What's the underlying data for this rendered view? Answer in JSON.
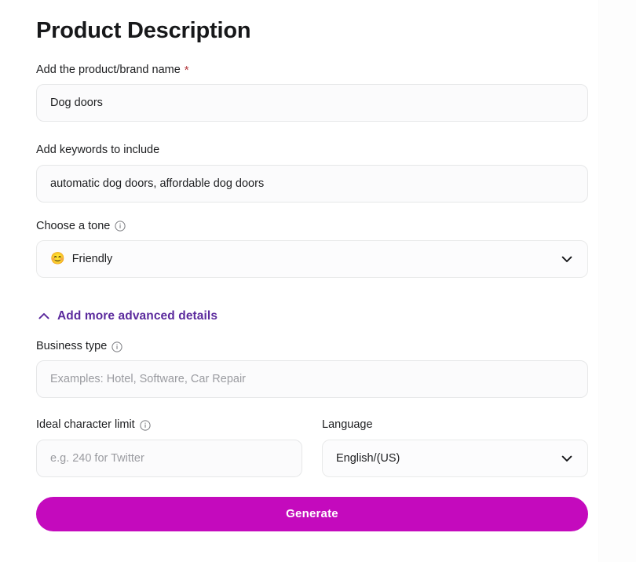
{
  "header": {
    "title": "Product Description"
  },
  "colors": {
    "accent_purple": "#5b2a9d",
    "brand_magenta": "#c40abd",
    "required_star": "#b3373c",
    "text_primary": "#1d1e20",
    "placeholder": "#9a9ba0",
    "field_border": "#e6e7e8",
    "field_background": "#fbfbfc",
    "page_background": "#ffffff"
  },
  "fields": {
    "product_name": {
      "label": "Add the product/brand name",
      "required_marker": "*",
      "value": "Dog doors",
      "placeholder": ""
    },
    "keywords": {
      "label": "Add keywords to include",
      "value": "automatic dog doors, affordable dog doors",
      "placeholder": ""
    },
    "tone": {
      "label": "Choose a tone",
      "info_icon": "info-circle-icon",
      "selected_emoji": "😊",
      "selected_value": "Friendly",
      "chevron_icon": "chevron-down-icon",
      "options": [
        "Friendly"
      ]
    },
    "business_type": {
      "label": "Business type",
      "info_icon": "info-circle-icon",
      "value": "",
      "placeholder": "Examples: Hotel, Software, Car Repair"
    },
    "character_limit": {
      "label": "Ideal character limit",
      "info_icon": "info-circle-icon",
      "value": "",
      "placeholder": "e.g. 240 for Twitter"
    },
    "language": {
      "label": "Language",
      "selected_value": "English/(US)",
      "chevron_icon": "chevron-down-icon",
      "options": [
        "English/(US)"
      ]
    }
  },
  "advanced": {
    "label": "Add more advanced details",
    "caret_icon": "chevron-up-icon",
    "expanded": true
  },
  "actions": {
    "generate_label": "Generate"
  }
}
